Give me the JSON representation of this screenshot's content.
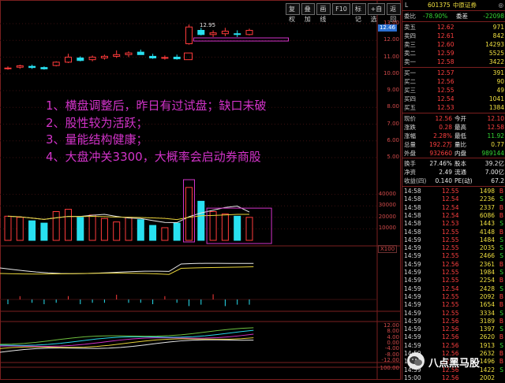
{
  "toolbar": {
    "buttons": [
      "复权",
      "叠加",
      "画线",
      "F10",
      "标记",
      "+自选",
      "返回"
    ]
  },
  "annotation": {
    "lines": [
      "1、横盘调整后，昨日有过试盘；缺口未破",
      "2、股性较为活跃；",
      "3、量能结构健康；",
      "4、大盘冲关3300，大概率会启动券商股"
    ]
  },
  "price_axis": [
    "13.00",
    "12.00",
    "11.00",
    "10.00",
    "9.00",
    "8.00",
    "7.00",
    "6.00",
    "5.00"
  ],
  "volume_axis": [
    "40000",
    "30000",
    "20000",
    "10000",
    "X100"
  ],
  "indicator_axis_top": [
    "12.00",
    "8.00",
    "4.00",
    "0.00",
    "-4.00",
    "-8.00",
    "-12.00"
  ],
  "bottom_axis": [
    "100.00"
  ],
  "chart_labels": {
    "high": "12.95",
    "current_tag": "12.46",
    "unit_tag": "X100"
  },
  "chart_data": {
    "type": "candlestick",
    "candles": [
      {
        "o": 10.35,
        "h": 10.45,
        "l": 10.25,
        "c": 10.35,
        "up": true
      },
      {
        "o": 10.4,
        "h": 10.55,
        "l": 10.3,
        "c": 10.48,
        "up": true
      },
      {
        "o": 10.45,
        "h": 10.55,
        "l": 10.3,
        "c": 10.38,
        "up": false
      },
      {
        "o": 10.38,
        "h": 10.45,
        "l": 10.25,
        "c": 10.3,
        "up": false
      },
      {
        "o": 10.5,
        "h": 10.75,
        "l": 10.45,
        "c": 10.7,
        "up": true
      },
      {
        "o": 10.7,
        "h": 11.2,
        "l": 10.65,
        "c": 11.0,
        "up": true
      },
      {
        "o": 10.95,
        "h": 11.05,
        "l": 10.75,
        "c": 10.8,
        "up": false
      },
      {
        "o": 10.85,
        "h": 11.1,
        "l": 10.75,
        "c": 11.0,
        "up": true
      },
      {
        "o": 10.95,
        "h": 11.15,
        "l": 10.85,
        "c": 11.05,
        "up": true
      },
      {
        "o": 11.05,
        "h": 11.4,
        "l": 10.95,
        "c": 11.15,
        "up": true
      },
      {
        "o": 11.15,
        "h": 11.35,
        "l": 11.0,
        "c": 11.25,
        "up": true
      },
      {
        "o": 11.3,
        "h": 11.45,
        "l": 11.15,
        "c": 11.15,
        "up": false
      },
      {
        "o": 11.05,
        "h": 11.2,
        "l": 10.9,
        "c": 10.95,
        "up": false
      },
      {
        "o": 10.95,
        "h": 11.1,
        "l": 10.85,
        "c": 10.98,
        "up": true
      },
      {
        "o": 11.0,
        "h": 11.15,
        "l": 10.85,
        "c": 10.9,
        "up": false
      },
      {
        "o": 11.8,
        "h": 12.95,
        "l": 11.75,
        "c": 12.8,
        "up": true
      },
      {
        "o": 12.6,
        "h": 12.75,
        "l": 12.3,
        "c": 12.35,
        "up": false
      },
      {
        "o": 12.35,
        "h": 12.6,
        "l": 12.2,
        "c": 12.45,
        "up": true
      },
      {
        "o": 12.4,
        "h": 12.75,
        "l": 12.25,
        "c": 12.55,
        "up": true
      },
      {
        "o": 12.4,
        "h": 12.6,
        "l": 12.2,
        "c": 12.35,
        "up": false
      },
      {
        "o": 12.35,
        "h": 12.7,
        "l": 12.3,
        "c": 12.6,
        "up": true
      }
    ],
    "volumes": [
      21000,
      20000,
      17000,
      15000,
      25000,
      27000,
      20000,
      22000,
      19000,
      16000,
      20000,
      18000,
      13000,
      11000,
      15000,
      46000,
      34000,
      25000,
      23000,
      21000,
      20000
    ]
  },
  "panel": {
    "code": "601375",
    "name": "中原证券",
    "weibi_label": "委比",
    "weibi": "-78.90%",
    "weicha_label": "委差",
    "weicha": "-22098",
    "sells": [
      {
        "label": "卖五",
        "price": "12.62",
        "vol": "971"
      },
      {
        "label": "卖四",
        "price": "12.61",
        "vol": "842"
      },
      {
        "label": "卖三",
        "price": "12.60",
        "vol": "14293"
      },
      {
        "label": "卖二",
        "price": "12.59",
        "vol": "5525"
      },
      {
        "label": "卖一",
        "price": "12.58",
        "vol": "3422"
      }
    ],
    "buys": [
      {
        "label": "买一",
        "price": "12.57",
        "vol": "391"
      },
      {
        "label": "买二",
        "price": "12.56",
        "vol": "90"
      },
      {
        "label": "买三",
        "price": "12.55",
        "vol": "49"
      },
      {
        "label": "买四",
        "price": "12.54",
        "vol": "1041"
      },
      {
        "label": "买五",
        "price": "12.53",
        "vol": "1384"
      }
    ],
    "stats": [
      {
        "l1": "现价",
        "v1": "12.56",
        "l2": "今开",
        "v2": "12.10"
      },
      {
        "l1": "涨跌",
        "v1": "0.28",
        "l2": "最高",
        "v2": "12.58"
      },
      {
        "l1": "涨幅",
        "v1": "2.28%",
        "l2": "最低",
        "v2": "11.92"
      },
      {
        "l1": "总量",
        "v1": "192.2万",
        "l2": "量比",
        "v2": "0.77"
      },
      {
        "l1": "外盘",
        "v1": "932660",
        "l2": "内盘",
        "v2": "989144"
      }
    ],
    "fund": [
      {
        "l1": "换手",
        "v1": "27.46%",
        "l2": "股本",
        "v2": "39.2亿"
      },
      {
        "l1": "净资",
        "v1": "2.49",
        "l2": "流通",
        "v2": "7.00亿"
      },
      {
        "l1": "收益(四)",
        "v1": "0.140",
        "l2": "PE(动)",
        "v2": "67.2"
      }
    ],
    "ticks": [
      {
        "t": "14:58",
        "p": "12.55",
        "v": "1498",
        "d": "B"
      },
      {
        "t": "14:58",
        "p": "12.54",
        "v": "2236",
        "d": "S"
      },
      {
        "t": "14:58",
        "p": "12.54",
        "v": "2337",
        "d": "B"
      },
      {
        "t": "14:58",
        "p": "12.54",
        "v": "6086",
        "d": "B"
      },
      {
        "t": "14:58",
        "p": "12.53",
        "v": "1443",
        "d": "S"
      },
      {
        "t": "14:58",
        "p": "12.55",
        "v": "4148",
        "d": "B"
      },
      {
        "t": "14:59",
        "p": "12.55",
        "v": "1484",
        "d": "S"
      },
      {
        "t": "14:59",
        "p": "12.55",
        "v": "2035",
        "d": "S"
      },
      {
        "t": "14:59",
        "p": "12.55",
        "v": "2466",
        "d": "S"
      },
      {
        "t": "14:59",
        "p": "12.56",
        "v": "2361",
        "d": "B"
      },
      {
        "t": "14:59",
        "p": "12.55",
        "v": "1984",
        "d": "S"
      },
      {
        "t": "14:59",
        "p": "12.55",
        "v": "2254",
        "d": "B"
      },
      {
        "t": "14:59",
        "p": "12.54",
        "v": "2428",
        "d": "S"
      },
      {
        "t": "14:59",
        "p": "12.55",
        "v": "2092",
        "d": "B"
      },
      {
        "t": "14:59",
        "p": "12.55",
        "v": "1654",
        "d": "B"
      },
      {
        "t": "14:59",
        "p": "12.55",
        "v": "3334",
        "d": "S"
      },
      {
        "t": "14:59",
        "p": "12.56",
        "v": "3189",
        "d": "B"
      },
      {
        "t": "14:59",
        "p": "12.56",
        "v": "1397",
        "d": "S"
      },
      {
        "t": "14:59",
        "p": "12.56",
        "v": "2620",
        "d": "B"
      },
      {
        "t": "14:59",
        "p": "12.56",
        "v": "1913",
        "d": "S"
      },
      {
        "t": "14:59",
        "p": "12.56",
        "v": "2632",
        "d": "B"
      },
      {
        "t": "14:59",
        "p": "12.57",
        "v": "1496",
        "d": "B"
      },
      {
        "t": "14:59",
        "p": "12.56",
        "v": "1422",
        "d": "S"
      },
      {
        "t": "15:00",
        "p": "12.56",
        "v": "2002",
        "d": ""
      }
    ]
  },
  "watermark": {
    "text": "八点黑马股",
    "icon": "wechat-icon"
  },
  "colors": {
    "up": "#ff3b3b",
    "down": "#28e0f0",
    "annotation": "#d233c9",
    "grid": "#7a1f1f"
  }
}
